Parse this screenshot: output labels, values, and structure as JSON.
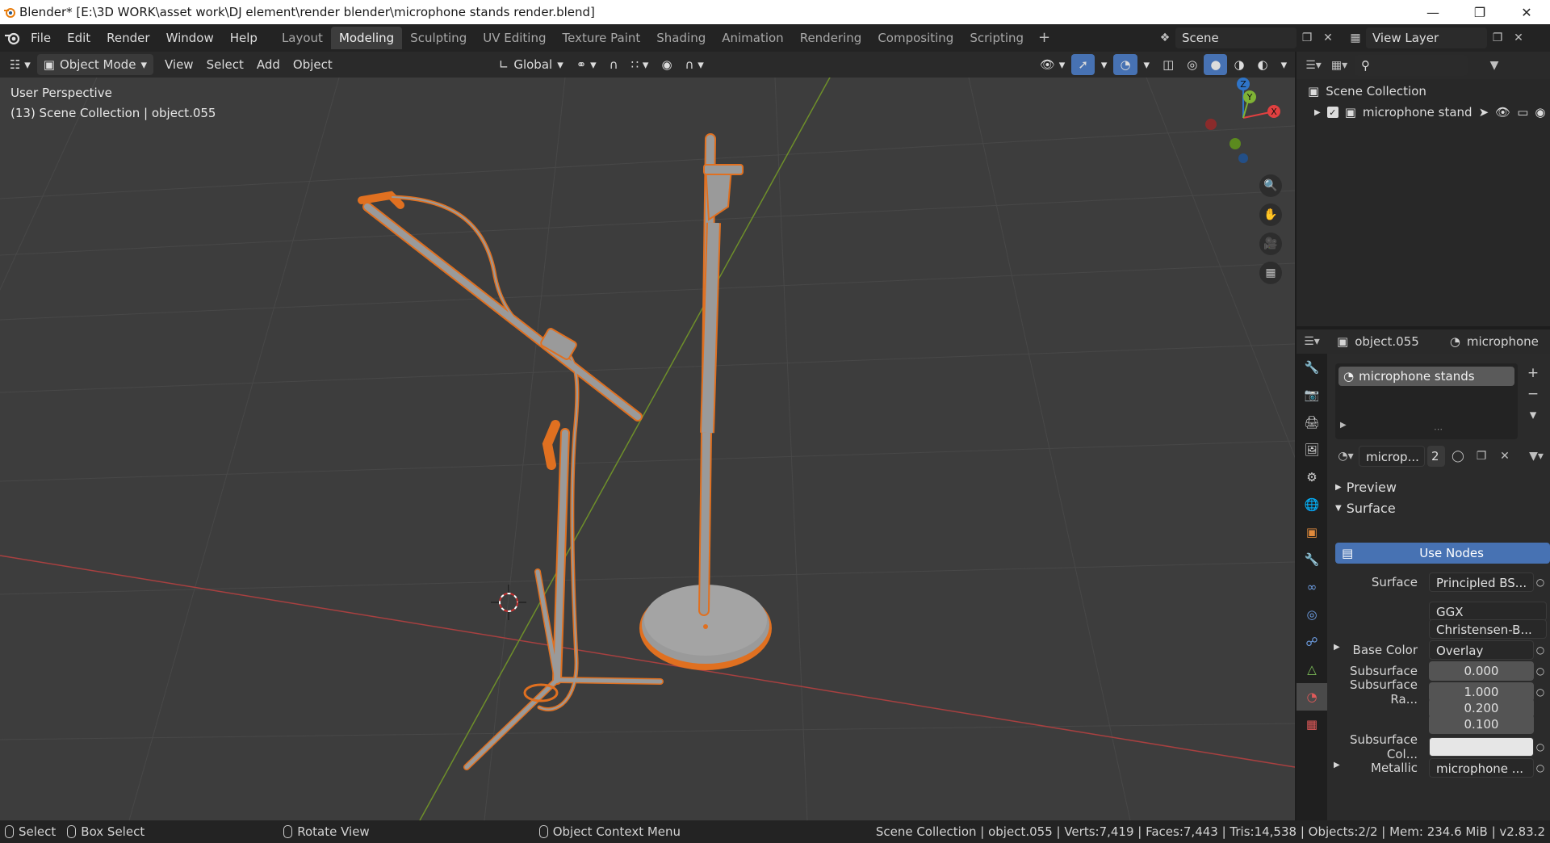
{
  "window": {
    "title": "Blender* [E:\\3D WORK\\asset work\\DJ element\\render blender\\microphone stands render.blend]",
    "controls": [
      "minimize",
      "restore",
      "close"
    ]
  },
  "menu": {
    "items": [
      "File",
      "Edit",
      "Render",
      "Window",
      "Help"
    ]
  },
  "workspaces": {
    "tabs": [
      "Layout",
      "Modeling",
      "Sculpting",
      "UV Editing",
      "Texture Paint",
      "Shading",
      "Animation",
      "Rendering",
      "Compositing",
      "Scripting"
    ],
    "active": "Modeling",
    "add": "+"
  },
  "scene": {
    "name": "Scene",
    "view_layer": "View Layer"
  },
  "viewport_header": {
    "mode": "Object Mode",
    "menus": [
      "View",
      "Select",
      "Add",
      "Object"
    ],
    "orientation": "Global"
  },
  "viewport": {
    "perspective": "User Perspective",
    "collection_info": "(13) Scene Collection | object.055",
    "gizmo": {
      "z": "Z",
      "y": "Y",
      "x": "X"
    },
    "colors": {
      "background": "#3d3d3d",
      "grid": "#4a4a4a",
      "x_axis": "#a84040",
      "y_axis": "#6e8f2a",
      "selected": "#e07020",
      "model": "#9a9a9a"
    }
  },
  "outliner": {
    "root": "Scene Collection",
    "items": [
      {
        "label": "microphone stand",
        "checked": true
      }
    ]
  },
  "properties": {
    "object_name": "object.055",
    "material_name_header": "microphone",
    "slots": [
      "microphone stands"
    ],
    "material_short": "microp...",
    "users": "2",
    "sections": {
      "preview": "Preview",
      "surface": "Surface"
    },
    "use_nodes": "Use Nodes",
    "rows": [
      {
        "label": "Surface",
        "value": "Principled BS...",
        "kind": "text"
      },
      {
        "label": "",
        "value": "GGX",
        "kind": "select"
      },
      {
        "label": "",
        "value": "Christensen-B...",
        "kind": "select"
      },
      {
        "label": "Base Color",
        "value": "Overlay",
        "kind": "text",
        "expand": true
      },
      {
        "label": "Subsurface",
        "value": "0.000",
        "kind": "num"
      },
      {
        "label": "Subsurface Ra...",
        "value": "1.000",
        "kind": "num"
      },
      {
        "label": "",
        "value": "0.200",
        "kind": "num"
      },
      {
        "label": "",
        "value": "0.100",
        "kind": "num"
      },
      {
        "label": "Subsurface Col...",
        "value": "",
        "kind": "color"
      },
      {
        "label": "Metallic",
        "value": "microphone ...",
        "kind": "text",
        "expand": true
      }
    ],
    "accent": "#4772b3"
  },
  "statusbar": {
    "select": "Select",
    "box_select": "Box Select",
    "rotate": "Rotate View",
    "context": "Object Context Menu",
    "stats": "Scene Collection | object.055 | Verts:7,419 | Faces:7,443 | Tris:14,538 | Objects:2/2 | Mem: 234.6 MiB | v2.83.2"
  }
}
